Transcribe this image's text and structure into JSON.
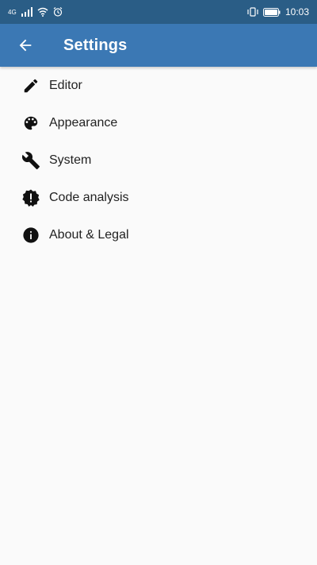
{
  "status_bar": {
    "network_label": "4G",
    "time": "10:03",
    "icons": [
      "signal-icon",
      "wifi-icon",
      "alarm-icon",
      "vibrate-icon",
      "battery-icon"
    ]
  },
  "app_bar": {
    "title": "Settings",
    "back_icon": "arrow-back-icon",
    "color": "#3b78b4"
  },
  "settings": {
    "items": [
      {
        "label": "Editor",
        "icon": "pencil-icon"
      },
      {
        "label": "Appearance",
        "icon": "palette-icon"
      },
      {
        "label": "System",
        "icon": "wrench-icon"
      },
      {
        "label": "Code analysis",
        "icon": "alert-badge-icon"
      },
      {
        "label": "About & Legal",
        "icon": "info-icon"
      }
    ]
  }
}
